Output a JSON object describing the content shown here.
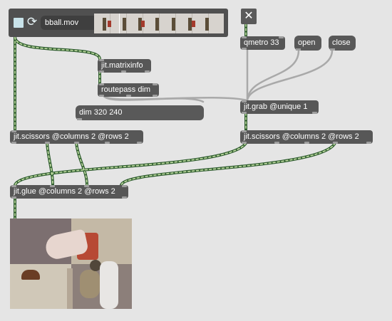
{
  "player": {
    "filename": "bball.mov",
    "toggle_icon": "toggle-square-icon",
    "loop_icon": "loop-icon",
    "loop_glyph": "⟳"
  },
  "toggle_x": {
    "glyph": "✕",
    "icon": "close-x-icon"
  },
  "objects": {
    "matrixinfo": "jit.matrixinfo",
    "routepass": "routepass dim",
    "qmetro": "qmetro 33",
    "grab": "jit.grab @unique 1",
    "scissors_left": "jit.scissors @columns 2 @rows 2",
    "scissors_right": "jit.scissors @columns 2 @rows 2",
    "glue": "jit.glue @columns 2 @rows 2"
  },
  "messages": {
    "open": "open",
    "close": "close",
    "dim": "dim 320 240"
  },
  "colors": {
    "background": "#e5e5e5",
    "object_fill": "#575757",
    "object_text": "#ffffff",
    "patchcord_matrix": "#3a6b3a",
    "patchcord_matrix_dash": "#b9d89a",
    "patchcord_message": "#a8a8a8"
  }
}
